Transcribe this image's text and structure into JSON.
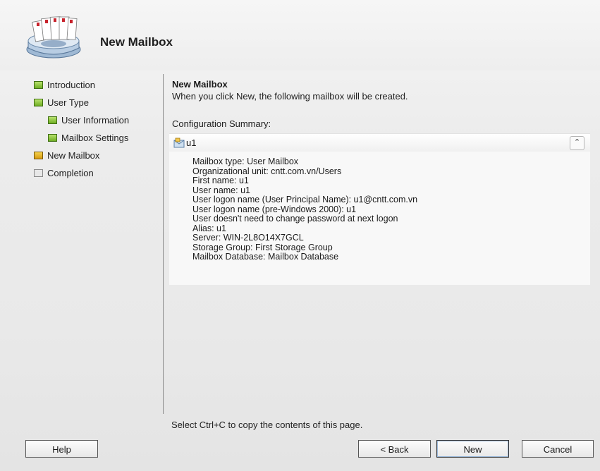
{
  "header": {
    "title": "New Mailbox",
    "icon": "mailbox-wizard-icon"
  },
  "nav": {
    "items": [
      {
        "label": "Introduction",
        "status": "green"
      },
      {
        "label": "User Type",
        "status": "green"
      },
      {
        "label": "User Information",
        "status": "green"
      },
      {
        "label": "Mailbox Settings",
        "status": "green"
      },
      {
        "label": "New Mailbox",
        "status": "yellow"
      },
      {
        "label": "Completion",
        "status": "gray"
      }
    ]
  },
  "content": {
    "title": "New Mailbox",
    "description": "When you click New, the following mailbox will be created.",
    "config_label": "Configuration Summary:",
    "summary": {
      "name": "u1",
      "lines": [
        "Mailbox type: User Mailbox",
        "Organizational unit: cntt.com.vn/Users",
        "First name: u1",
        "User name: u1",
        "User logon name (User Principal Name): u1@cntt.com.vn",
        "User logon name (pre-Windows 2000): u1",
        "User doesn't need to change password at next logon",
        "Alias: u1",
        "Server: WIN-2L8O14X7GCL",
        "Storage Group: First Storage Group",
        "Mailbox Database: Mailbox Database"
      ]
    },
    "footer_hint": "Select Ctrl+C to copy the contents of this page."
  },
  "buttons": {
    "help": "Help",
    "back": "< Back",
    "new": "New",
    "cancel": "Cancel"
  },
  "colors": {
    "status_green": "#6fae23",
    "status_yellow": "#d69a10",
    "status_gray": "#e8e8e8"
  }
}
